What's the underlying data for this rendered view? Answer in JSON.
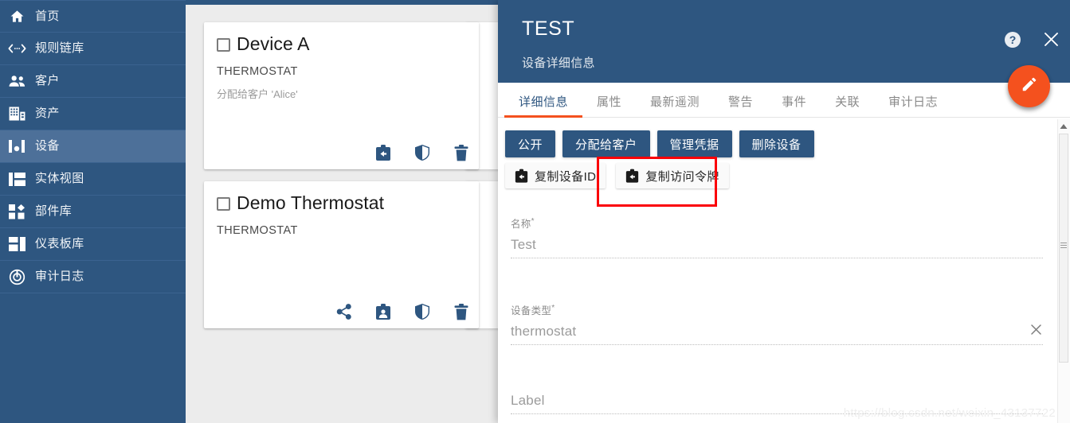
{
  "sidebar": {
    "items": [
      {
        "label": "首页",
        "icon": "home-icon",
        "active": false
      },
      {
        "label": "规则链库",
        "icon": "rule-chain-icon",
        "active": false
      },
      {
        "label": "客户",
        "icon": "customers-icon",
        "active": false
      },
      {
        "label": "资产",
        "icon": "assets-icon",
        "active": false
      },
      {
        "label": "设备",
        "icon": "devices-icon",
        "active": true
      },
      {
        "label": "实体视图",
        "icon": "entity-view-icon",
        "active": false
      },
      {
        "label": "部件库",
        "icon": "widgets-library-icon",
        "active": false
      },
      {
        "label": "仪表板库",
        "icon": "dashboards-icon",
        "active": false
      },
      {
        "label": "审计日志",
        "icon": "audit-log-icon",
        "active": false
      }
    ]
  },
  "device_list": {
    "cards": [
      {
        "name": "Device A",
        "type": "THERMOSTAT",
        "note": "分配给客户 'Alice'",
        "actions": [
          "unassign-icon",
          "shield-icon",
          "delete-icon"
        ]
      },
      {
        "name": "Demo Thermostat",
        "type": "THERMOSTAT",
        "note": "",
        "actions": [
          "share-icon",
          "assign-icon",
          "shield-icon",
          "delete-icon"
        ]
      }
    ]
  },
  "panel": {
    "title": "TEST",
    "subtitle": "设备详细信息",
    "help_icon": "help-icon",
    "close_icon": "close-icon",
    "edit_fab_icon": "pencil-icon",
    "accent_color": "#f4511e",
    "brand_color": "#2e5680",
    "tabs": [
      {
        "label": "详细信息",
        "active": true
      },
      {
        "label": "属性",
        "active": false
      },
      {
        "label": "最新遥测",
        "active": false
      },
      {
        "label": "警告",
        "active": false
      },
      {
        "label": "事件",
        "active": false
      },
      {
        "label": "关联",
        "active": false
      },
      {
        "label": "审计日志",
        "active": false
      }
    ],
    "primary_buttons": [
      {
        "label": "公开"
      },
      {
        "label": "分配给客户"
      },
      {
        "label": "管理凭据"
      },
      {
        "label": "删除设备"
      }
    ],
    "copy_buttons": [
      {
        "label": "复制设备ID",
        "icon": "copy-icon",
        "highlighted": false
      },
      {
        "label": "复制访问令牌",
        "icon": "copy-icon",
        "highlighted": true
      }
    ],
    "highlight_color": "#fb0007",
    "form": {
      "fields": [
        {
          "label": "名称",
          "required": true,
          "value": "Test",
          "clearable": false
        },
        {
          "label": "设备类型",
          "required": true,
          "value": "thermostat",
          "clearable": true,
          "clear_icon": "close-icon"
        },
        {
          "label": "",
          "required": false,
          "value": "Label",
          "clearable": false
        }
      ],
      "required_marker": "*"
    }
  },
  "watermark": {
    "text": "https://blog.csdn.net/weixin_43137722"
  }
}
